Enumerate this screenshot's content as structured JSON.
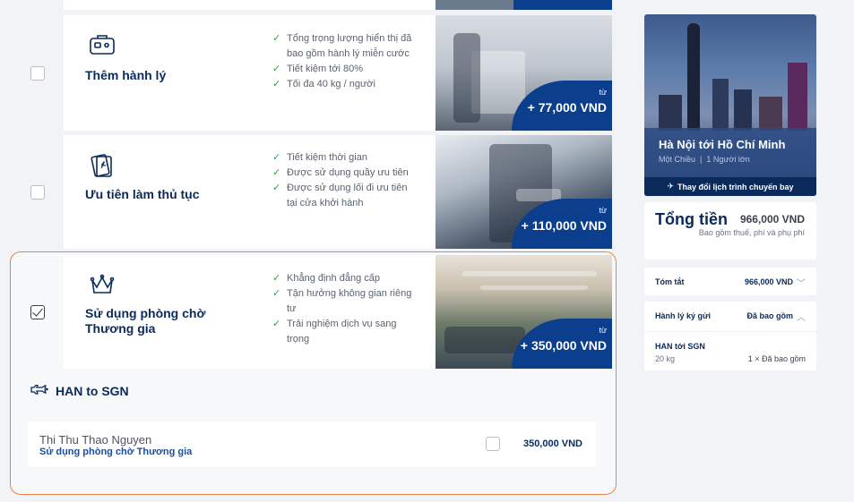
{
  "addons": [
    {
      "title": "Thêm hành lý",
      "features": [
        "Tổng trọng lượng hiển thị đã bao gồm hành lý miễn cước",
        "Tiết kiệm tới 80%",
        "Tối đa 40 kg / người"
      ],
      "price_from": "từ",
      "price": "+ 77,000 VND",
      "checked": false
    },
    {
      "title": "Ưu tiên làm thủ tục",
      "features": [
        "Tiết kiệm thời gian",
        "Được sử dụng quầy ưu tiên",
        "Được sử dụng lối đi ưu tiên tại cửa khởi hành"
      ],
      "price_from": "từ",
      "price": "+ 110,000 VND",
      "checked": false
    },
    {
      "title": "Sử dụng phòng chờ Thương gia",
      "features": [
        "Khẳng định đẳng cấp",
        "Tận hưởng không gian riêng tư",
        "Trải nghiệm dịch vụ sang trọng"
      ],
      "price_from": "từ",
      "price": "+ 350,000 VND",
      "checked": true
    }
  ],
  "selection": {
    "route": "HAN to SGN",
    "passenger_name": "Thi Thu Thao Nguyen",
    "service": "Sử dụng phòng chờ Thương gia",
    "price": "350,000 VND"
  },
  "sidebar": {
    "trip_route": "Hà Nội tới Hồ Chí Minh",
    "trip_type": "Một Chiều",
    "passengers": "1 Người lớn",
    "change_label": "Thay đổi lịch trình chuyến bay",
    "total_label": "Tổng tiền",
    "total_amount": "966,000 VND",
    "total_note": "Bao gồm thuế, phí và phụ phí",
    "summary_label": "Tóm tắt",
    "summary_value": "966,000 VND",
    "bag_label": "Hành lý ký gửi",
    "bag_value": "Đã bao gồm",
    "bag_route": "HAN tới SGN",
    "bag_weight": "20 kg",
    "bag_qty": "1 × Đã bao gồm"
  },
  "colors": {
    "brand_navy": "#0a2a5c",
    "brand_blue": "#0b3e8c",
    "check_green": "#2ca24a",
    "highlight_border": "#e8834d"
  }
}
